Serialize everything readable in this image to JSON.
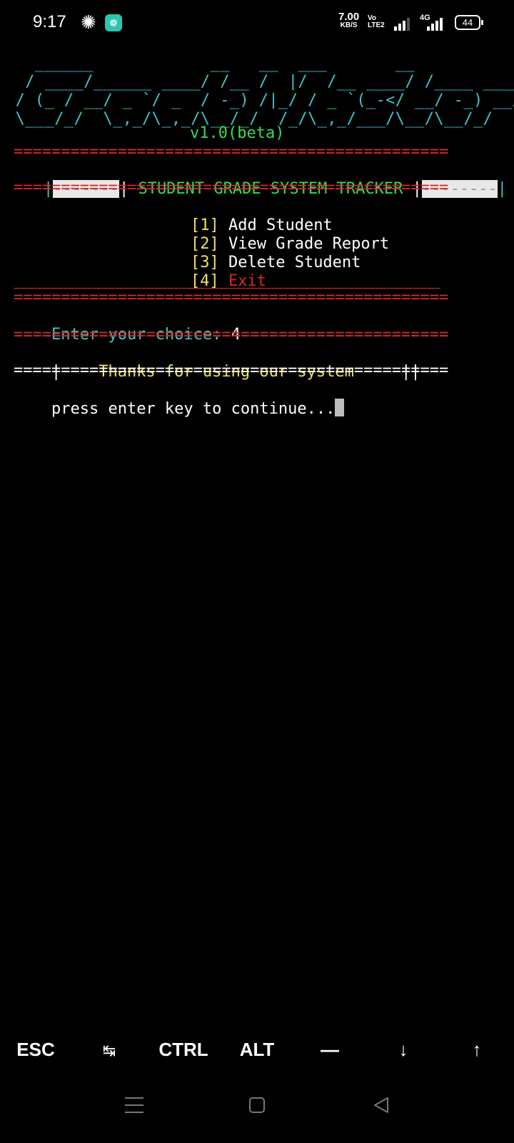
{
  "status_bar": {
    "time": "9:17",
    "pinwheel_icon": "pinwheel-icon",
    "app_icon": "app-notification-icon",
    "speed_value": "7.00",
    "speed_unit": "KB/S",
    "volte_top": "Vo",
    "volte_bottom": "LTE2",
    "network_type": "4G",
    "battery_level": "44"
  },
  "terminal": {
    "ascii_banner": [
      "   ______            __   __  ___       __",
      "  / ____/______ ____/ /__ /  |/  /__ ____/ /____ ____",
      " / (_ / __/ _ `/ _  / -_) /|_/ / _ `(_-</ __/ -_) __/",
      " \\___/_/  \\_,_/\\_,_/\\__/_/  /_/\\_,_/___/\\__/\\__/_/"
    ],
    "version": "v1.0(beta)",
    "separator": "==============================================",
    "title_left_edge": "|",
    "title_left_block": "-------",
    "title_mid_open": "|",
    "title": " STUDENT GRADE SYSTEM TRACKER ",
    "title_mid_close": "|",
    "title_right_block": "--------",
    "title_right_edge": "|",
    "menu": [
      {
        "key": "[1]",
        "label": "Add Student"
      },
      {
        "key": "[2]",
        "label": "View Grade Report"
      },
      {
        "key": "[3]",
        "label": "Delete Student"
      },
      {
        "key": "[4]",
        "label": "Exit"
      }
    ],
    "prompt_label": "Enter your choice:",
    "prompt_value": "4",
    "thanks_open": "|",
    "thanks_text": "Thanks for using our system",
    "thanks_close": "||",
    "continue_text": "press enter key to continue...",
    "colors": {
      "cyan": "#3fc6cc",
      "green": "#33dd55",
      "red": "#d42a2a",
      "yellow": "#f0e060"
    }
  },
  "extra_keys": {
    "esc": "ESC",
    "tab": "↹",
    "ctrl": "CTRL",
    "alt": "ALT",
    "dash": "—",
    "down": "↓",
    "up": "↑"
  },
  "nav_bar": {
    "menu_icon": "menu-icon",
    "home_icon": "home-icon",
    "back_icon": "back-icon"
  }
}
